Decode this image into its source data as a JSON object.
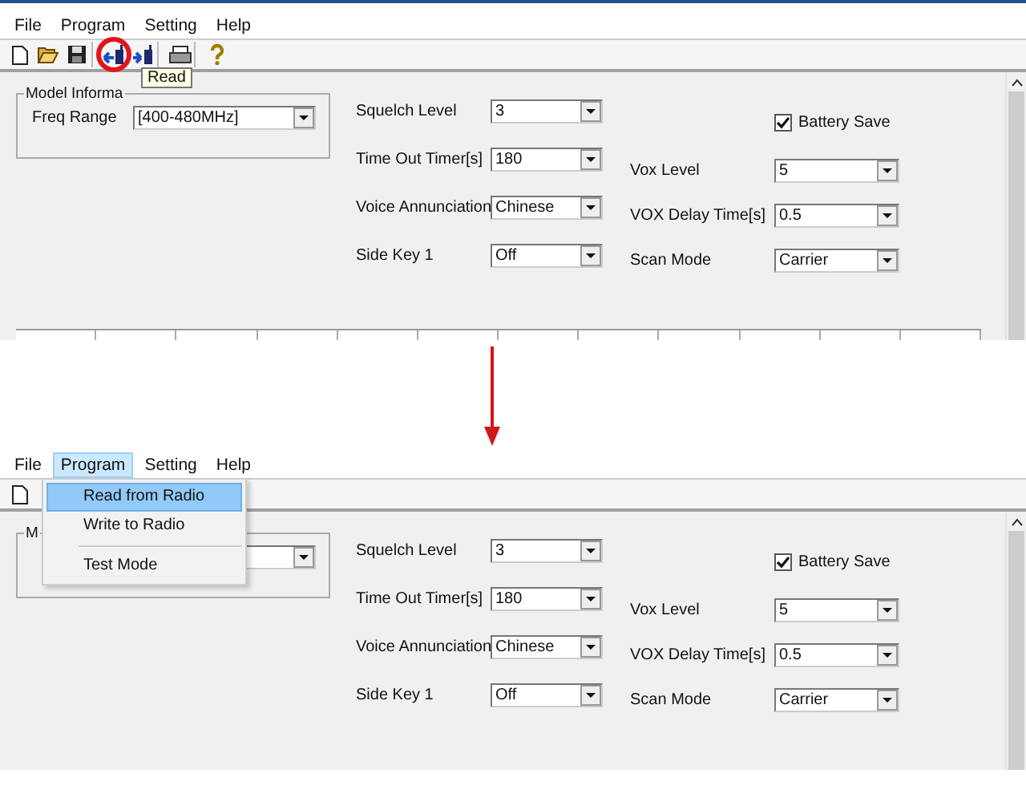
{
  "panels": [
    {
      "menu": [
        {
          "label": "File",
          "selected": false
        },
        {
          "label": "Program",
          "selected": false
        },
        {
          "label": "Setting",
          "selected": false
        },
        {
          "label": "Help",
          "selected": false
        }
      ],
      "toolbar": [
        {
          "kind": "new",
          "highlighted": false
        },
        {
          "kind": "open",
          "highlighted": false
        },
        {
          "kind": "save",
          "highlighted": false
        },
        {
          "kind": "read",
          "highlighted": true
        },
        {
          "kind": "write",
          "highlighted": false
        },
        {
          "kind": "print",
          "highlighted": false
        },
        {
          "kind": "help",
          "highlighted": false
        }
      ],
      "tooltip": "Read",
      "group_title": "Model Informa",
      "freq_range": {
        "label": "Freq Range",
        "value": "[400-480MHz]"
      },
      "left_fields": [
        {
          "label": "Squelch Level",
          "value": "3"
        },
        {
          "label": "Time Out Timer[s]",
          "value": "180"
        },
        {
          "label": "Voice Annunciation",
          "value": "Chinese"
        },
        {
          "label": "Side Key 1",
          "value": "Off"
        }
      ],
      "battery_save": {
        "label": "Battery Save",
        "checked": true
      },
      "right_fields": [
        {
          "label": "Vox Level",
          "value": "5"
        },
        {
          "label": "VOX Delay Time[s]",
          "value": "0.5"
        },
        {
          "label": "Scan Mode",
          "value": "Carrier"
        }
      ],
      "table_header": true
    },
    {
      "menu": [
        {
          "label": "File",
          "selected": false
        },
        {
          "label": "Program",
          "selected": true
        },
        {
          "label": "Setting",
          "selected": false
        },
        {
          "label": "Help",
          "selected": false
        }
      ],
      "menu_items": [
        {
          "kind": "item",
          "label": "Read from Radio",
          "selected": true
        },
        {
          "kind": "item",
          "label": "Write to Radio",
          "selected": false
        },
        {
          "kind": "separator"
        },
        {
          "kind": "item",
          "label": "Test Mode",
          "selected": false
        }
      ],
      "toolbar": [
        {
          "kind": "new",
          "highlighted": false
        }
      ],
      "group_title": "M",
      "left_fields": [
        {
          "label": "Squelch Level",
          "value": "3"
        },
        {
          "label": "Time Out Timer[s]",
          "value": "180"
        },
        {
          "label": "Voice Annunciation",
          "value": "Chinese"
        },
        {
          "label": "Side Key 1",
          "value": "Off"
        }
      ],
      "battery_save": {
        "label": "Battery Save",
        "checked": true
      },
      "right_fields": [
        {
          "label": "Vox Level",
          "value": "5"
        },
        {
          "label": "VOX Delay Time[s]",
          "value": "0.5"
        },
        {
          "label": "Scan Mode",
          "value": "Carrier"
        }
      ],
      "table_header": false
    }
  ]
}
